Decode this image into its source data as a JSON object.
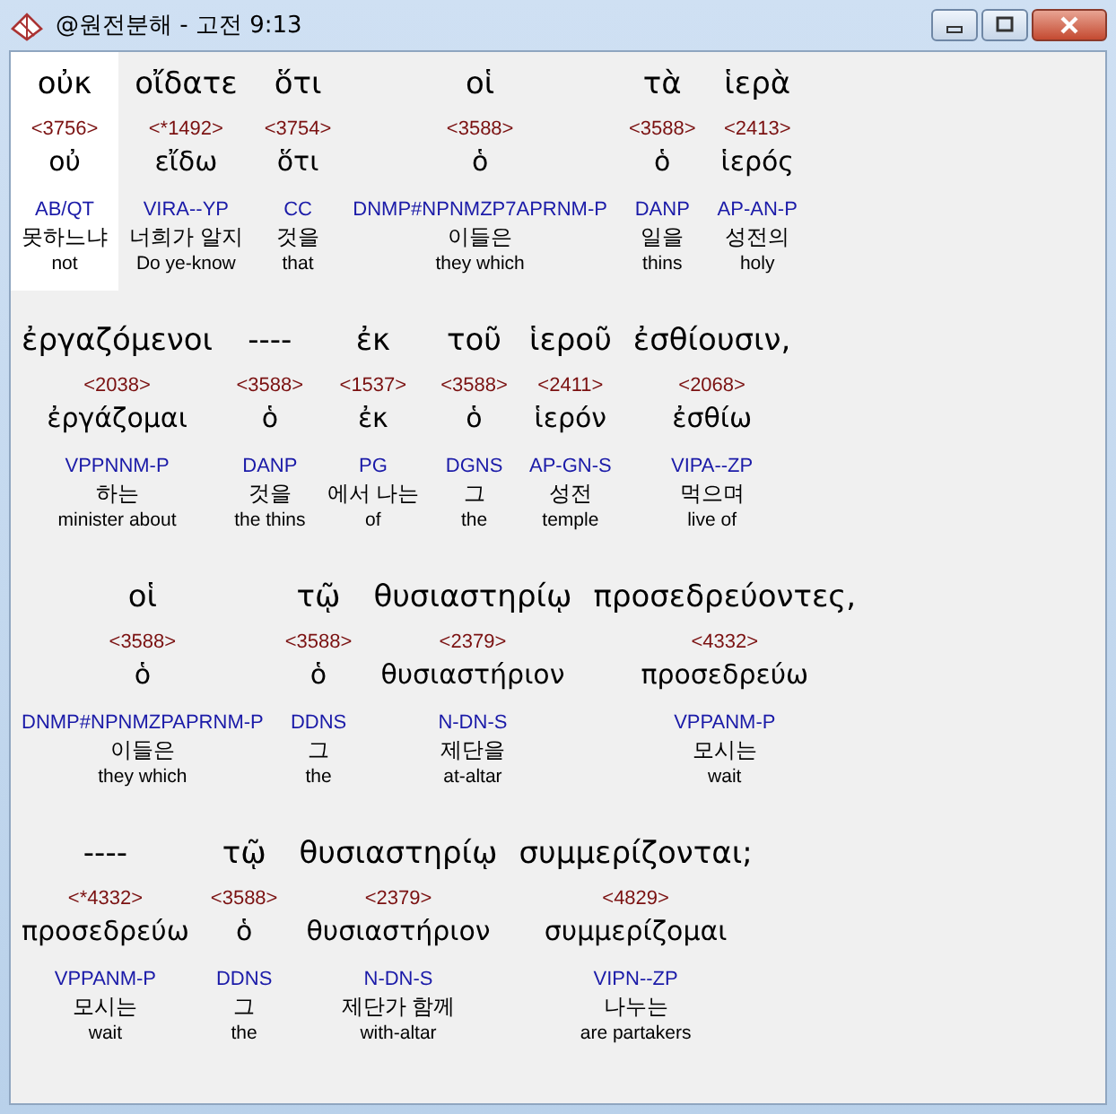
{
  "window": {
    "title": "@원전분해 - 고전 9:13"
  },
  "lines": [
    {
      "words": [
        {
          "greek": "οὐκ",
          "strong": "<3756>",
          "lemma": "οὐ",
          "parsing": "AB/QT",
          "korean": "못하느냐",
          "english": "not",
          "selected": true
        },
        {
          "greek": "οἴδατε",
          "strong": "<*1492>",
          "lemma": "εἴδω",
          "parsing": "VIRA--YP",
          "korean": "너희가 알지",
          "english": "Do ye-know",
          "selected": false
        },
        {
          "greek": "ὅτι",
          "strong": "<3754>",
          "lemma": "ὅτι",
          "parsing": "CC",
          "korean": "것을",
          "english": "that",
          "selected": false
        },
        {
          "greek": "οἱ",
          "strong": "<3588>",
          "lemma": "ὁ",
          "parsing": "DNMP#NPNMZP7APRNM-P",
          "korean": "이들은",
          "english": "they which",
          "selected": false
        },
        {
          "greek": "τὰ",
          "strong": "<3588>",
          "lemma": "ὁ",
          "parsing": "DANP",
          "korean": "일을",
          "english": "thins",
          "selected": false
        },
        {
          "greek": "ἱερὰ",
          "strong": "<2413>",
          "lemma": "ἱερός",
          "parsing": "AP-AN-P",
          "korean": "성전의",
          "english": "holy",
          "selected": false
        }
      ]
    },
    {
      "words": [
        {
          "greek": "ἐργαζόμενοι",
          "strong": "<2038>",
          "lemma": "ἐργάζομαι",
          "parsing": "VPPNNM-P",
          "korean": "하는",
          "english": "minister about",
          "selected": false
        },
        {
          "greek": "----",
          "strong": "<3588>",
          "lemma": "ὁ",
          "parsing": "DANP",
          "korean": "것을",
          "english": "the thins",
          "selected": false
        },
        {
          "greek": "ἐκ",
          "strong": "<1537>",
          "lemma": "ἐκ",
          "parsing": "PG",
          "korean": "에서 나는",
          "english": "of",
          "selected": false
        },
        {
          "greek": "τοῦ",
          "strong": "<3588>",
          "lemma": "ὁ",
          "parsing": "DGNS",
          "korean": "그",
          "english": "the",
          "selected": false
        },
        {
          "greek": "ἱεροῦ",
          "strong": "<2411>",
          "lemma": "ἱερόν",
          "parsing": "AP-GN-S",
          "korean": "성전",
          "english": "temple",
          "selected": false
        },
        {
          "greek": "ἐσθίουσιν,",
          "strong": "<2068>",
          "lemma": "ἐσθίω",
          "parsing": "VIPA--ZP",
          "korean": "먹으며",
          "english": "live of",
          "selected": false
        }
      ]
    },
    {
      "words": [
        {
          "greek": "οἱ",
          "strong": "<3588>",
          "lemma": "ὁ",
          "parsing": "DNMP#NPNMZPAPRNM-P",
          "korean": "이들은",
          "english": "they which",
          "selected": false
        },
        {
          "greek": "τῷ",
          "strong": "<3588>",
          "lemma": "ὁ",
          "parsing": "DDNS",
          "korean": "그",
          "english": "the",
          "selected": false
        },
        {
          "greek": "θυσιαστηρίῳ",
          "strong": "<2379>",
          "lemma": "θυσιαστήριον",
          "parsing": "N-DN-S",
          "korean": "제단을",
          "english": "at-altar",
          "selected": false
        },
        {
          "greek": "προσεδρεύοντες,",
          "strong": "<4332>",
          "lemma": "προσεδρεύω",
          "parsing": "VPPANM-P",
          "korean": "모시는",
          "english": "wait",
          "selected": false
        }
      ]
    },
    {
      "words": [
        {
          "greek": "----",
          "strong": "<*4332>",
          "lemma": "προσεδρεύω",
          "parsing": "VPPANM-P",
          "korean": "모시는",
          "english": "wait",
          "selected": false
        },
        {
          "greek": "τῷ",
          "strong": "<3588>",
          "lemma": "ὁ",
          "parsing": "DDNS",
          "korean": "그",
          "english": "the",
          "selected": false
        },
        {
          "greek": "θυσιαστηρίῳ",
          "strong": "<2379>",
          "lemma": "θυσιαστήριον",
          "parsing": "N-DN-S",
          "korean": "제단가 함께",
          "english": "with-altar",
          "selected": false
        },
        {
          "greek": "συμμερίζονται;",
          "strong": "<4829>",
          "lemma": "συμμερίζομαι",
          "parsing": "VIPN--ZP",
          "korean": "나누는",
          "english": "are partakers",
          "selected": false
        }
      ]
    }
  ]
}
